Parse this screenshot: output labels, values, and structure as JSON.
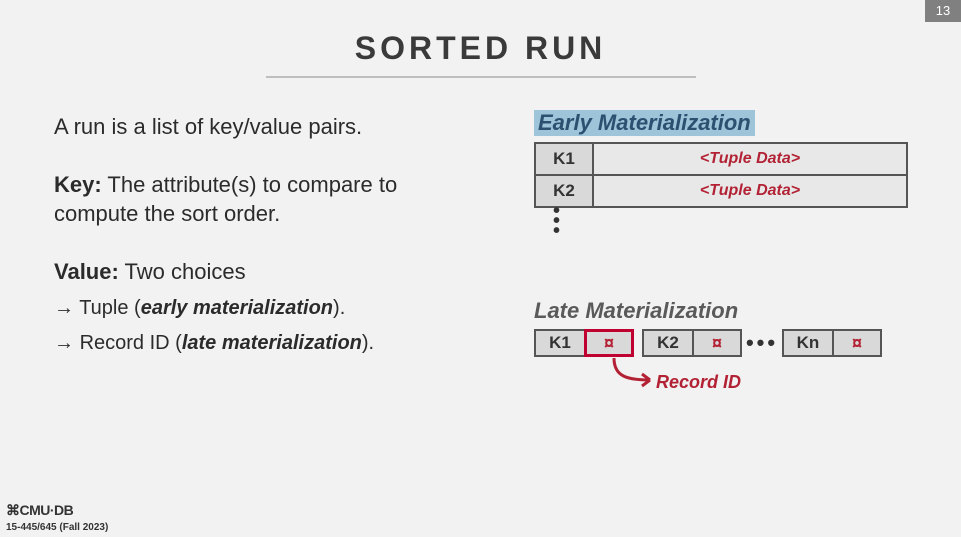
{
  "page_number": "13",
  "title": "SORTED RUN",
  "body": {
    "intro": "A run is a list of key/value pairs.",
    "key_label": "Key:",
    "key_text": " The attribute(s) to compare to compute the sort order.",
    "value_label": "Value:",
    "value_text": " Two choices",
    "arrow": "→",
    "choice1": {
      "pre": " Tuple (",
      "em": "early materialization",
      "post": ")."
    },
    "choice2": {
      "pre": " Record ID (",
      "em": "late materialization",
      "post": ")."
    }
  },
  "early": {
    "label": "Early Materialization",
    "rows": [
      {
        "key": "K1",
        "val": "<Tuple Data>"
      },
      {
        "key": "K2",
        "val": "<Tuple Data>"
      }
    ]
  },
  "late": {
    "label": "Late Materialization",
    "cells": [
      {
        "key": "K1",
        "val": "¤"
      },
      {
        "key": "K2",
        "val": "¤"
      },
      {
        "key": "Kn",
        "val": "¤"
      }
    ],
    "dots": "•••",
    "callout": "Record ID"
  },
  "footer": {
    "logo": "⌘CMU·DB",
    "course": "15-445/645 (Fall 2023)"
  }
}
